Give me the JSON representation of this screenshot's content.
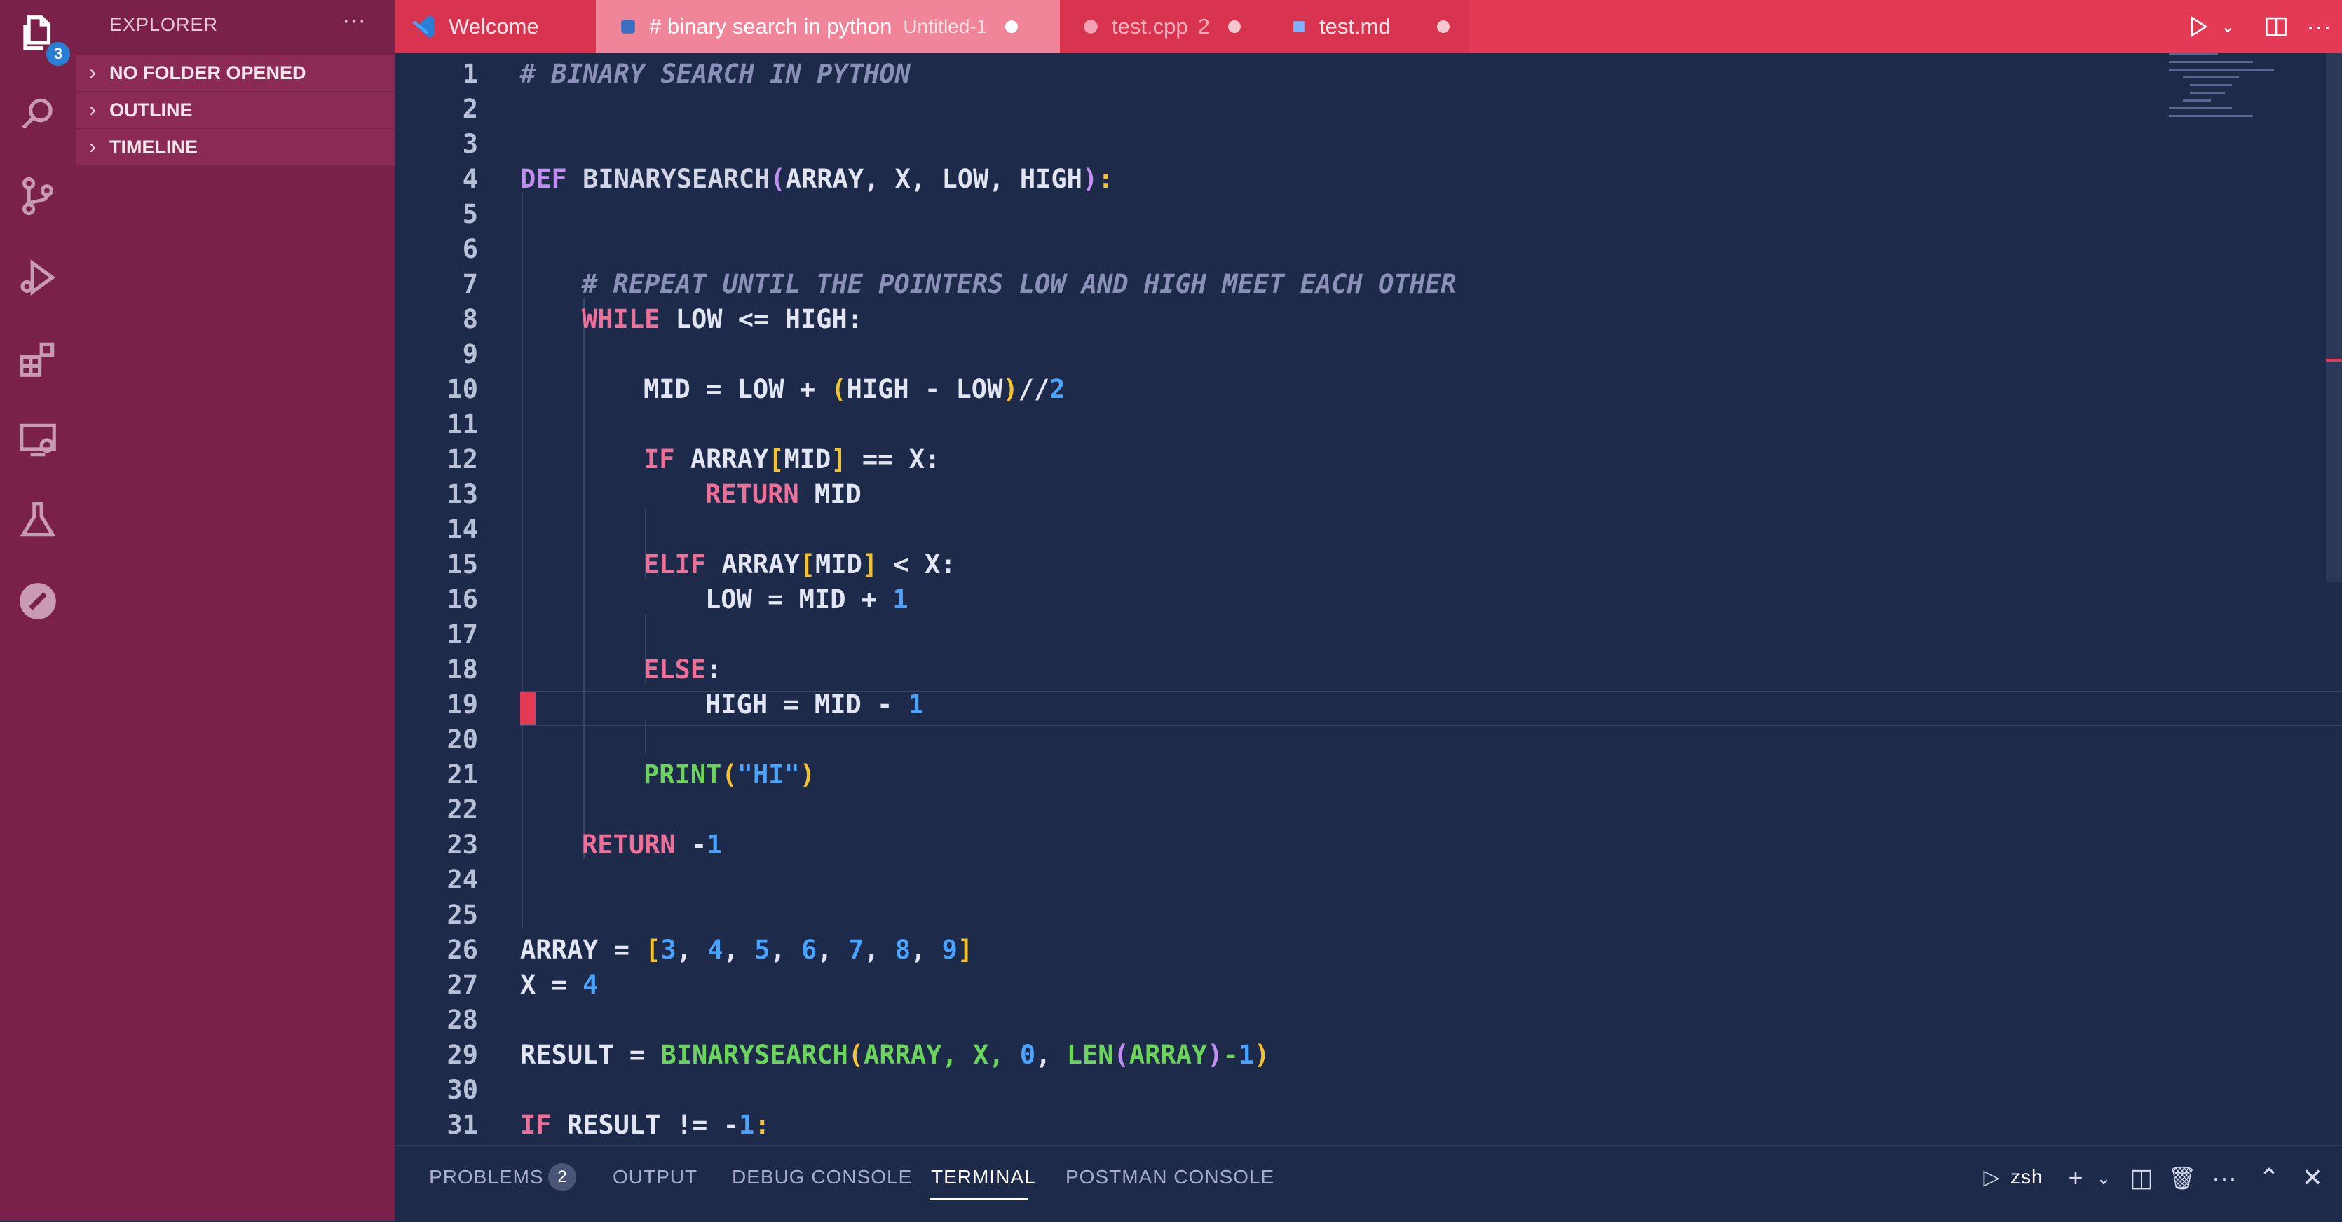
{
  "activity_bar": {
    "explorer_badge": "3",
    "icons": [
      "files-icon",
      "search-icon",
      "source-control-icon",
      "run-debug-icon",
      "extensions-icon",
      "remote-explorer-icon",
      "testing-icon",
      "postman-icon"
    ]
  },
  "sidebar": {
    "title": "EXPLORER",
    "more": "···",
    "sections": [
      "NO FOLDER OPENED",
      "OUTLINE",
      "TIMELINE"
    ]
  },
  "tabs": [
    {
      "label": "Welcome",
      "suffix": "",
      "icon": "vscode-icon"
    },
    {
      "label": "# binary search in python",
      "suffix": "Untitled-1",
      "icon": "python-icon"
    },
    {
      "label": "test.cpp",
      "suffix": "2",
      "icon": "cpp-icon"
    },
    {
      "label": "test.md",
      "suffix": "",
      "icon": "markdown-icon"
    }
  ],
  "code": {
    "line_numbers": [
      "1",
      "2",
      "3",
      "4",
      "5",
      "6",
      "7",
      "8",
      "9",
      "10",
      "11",
      "12",
      "13",
      "14",
      "15",
      "16",
      "17",
      "18",
      "19",
      "20",
      "21",
      "22",
      "23",
      "24",
      "25",
      "26",
      "27",
      "28",
      "29",
      "30",
      "31"
    ],
    "l1": "# BINARY SEARCH IN PYTHON",
    "l4": {
      "def": "DEF",
      "name": "BINARYSEARCH",
      "open": "(",
      "args": "ARRAY, X, LOW, HIGH",
      "close": ")",
      "colon": ":"
    },
    "l6": "# REPEAT UNTIL THE POINTERS LOW AND HIGH MEET EACH OTHER",
    "l7": {
      "kw": "WHILE",
      "rest": " LOW <= HIGH:"
    },
    "l9": {
      "a": "MID = LOW + ",
      "o": "(",
      "b": "HIGH - LOW",
      "c": ")",
      "d": "//",
      "n": "2"
    },
    "l11": {
      "kw": "IF",
      "a": " ARRAY",
      "o": "[",
      "b": "MID",
      "c": "]",
      "d": " == X:"
    },
    "l12": {
      "kw": "RETURN",
      "rest": " MID"
    },
    "l14": {
      "kw": "ELIF",
      "a": " ARRAY",
      "o": "[",
      "b": "MID",
      "c": "]",
      "d": " < X:"
    },
    "l15": {
      "a": "LOW = MID + ",
      "n": "1"
    },
    "l17": {
      "kw": "ELSE",
      "rest": ":"
    },
    "l18": {
      "a": "HIGH = MID - ",
      "n": "1"
    },
    "l20": {
      "fn": "PRINT",
      "o": "(",
      "s": "\"HI\"",
      "c": ")"
    },
    "l22": {
      "kw": "RETURN",
      "rest": " -",
      "n": "1"
    },
    "l25": {
      "a": "ARRAY = ",
      "o": "[",
      "nums": [
        "3",
        "4",
        "5",
        "6",
        "7",
        "8",
        "9"
      ],
      "c": "]"
    },
    "l26": {
      "a": "X = ",
      "n": "4"
    },
    "l28": {
      "a": "RESULT = ",
      "fn": "BINARYSEARCH",
      "o": "(",
      "b": "ARRAY, X, ",
      "z": "0",
      "sep": ", ",
      "len": "LEN",
      "o2": "(",
      "arr": "ARRAY",
      "c2": ")",
      "m": "-",
      "one": "1",
      "c": ")"
    },
    "l31": {
      "kw": "IF",
      "rest": " RESULT != -",
      "n": "1",
      "colon": ":"
    }
  },
  "panel": {
    "tabs": [
      "PROBLEMS",
      "OUTPUT",
      "DEBUG CONSOLE",
      "TERMINAL",
      "POSTMAN CONSOLE"
    ],
    "problems_count": "2",
    "active_tab": "TERMINAL",
    "shell": "zsh"
  },
  "colors": {
    "accent": "#e53a56",
    "sidebar": "#7a2149",
    "editor_bg": "#1e2a4a"
  }
}
